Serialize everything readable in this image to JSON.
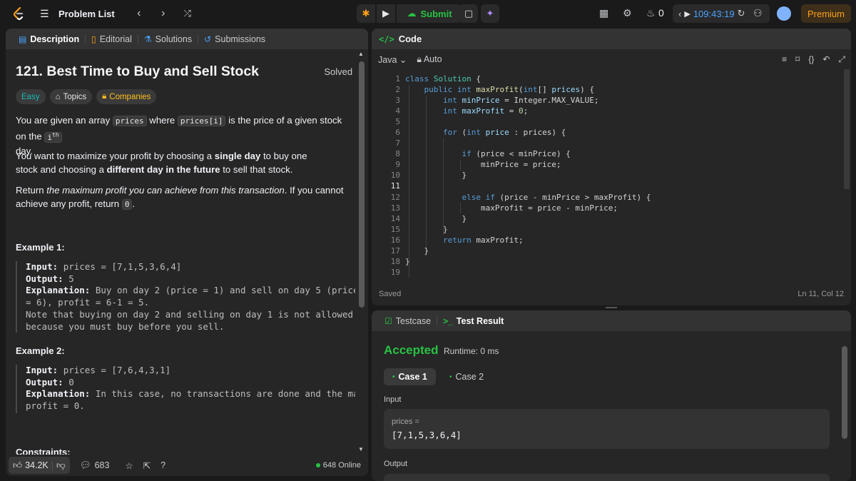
{
  "nav": {
    "problem_list_label": "Problem List",
    "submit_label": "Submit",
    "streak_count": "0",
    "timer": "109:43:19",
    "premium_label": "Premium"
  },
  "left": {
    "tabs": [
      "Description",
      "Editorial",
      "Solutions",
      "Submissions"
    ],
    "title": "121. Best Time to Buy and Sell Stock",
    "solved_label": "Solved",
    "tags": [
      "Easy",
      "Topics",
      "Companies"
    ],
    "p1_a": "You are given an array ",
    "p1_code1": "prices",
    "p1_b": " where ",
    "p1_code2": "prices[i]",
    "p1_c": " is the price of a given stock on the ",
    "p1_code3": "i",
    "p1_sup": "th",
    "p1_d": "day.",
    "p2_a": "You want to maximize your profit by choosing a ",
    "p2_b1": "single day",
    "p2_b": " to buy one stock and choosing a ",
    "p2_b2": "different day in the future",
    "p2_c": " to sell that stock.",
    "p3_a": "Return ",
    "p3_i": "the maximum profit you can achieve from this transaction",
    "p3_b": ". If you cannot achieve any profit, return ",
    "p3_code": "0",
    "p3_c": ".",
    "ex1_title": "Example 1:",
    "ex1_input": "prices = [7,1,5,3,6,4]",
    "ex1_output": "5",
    "ex1_expl": "Buy on day 2 (price = 1) and sell on day 5 (price",
    "ex1_expl2": "= 6), profit = 6-1 = 5.",
    "ex1_note1": "Note that buying on day 2 and selling on day 1 is not allowed",
    "ex1_note2": "because you must buy before you sell.",
    "ex2_title": "Example 2:",
    "ex2_input": "prices = [7,6,4,3,1]",
    "ex2_output": "0",
    "ex2_expl": "In this case, no transactions are done and the max",
    "ex2_expl2": "profit = 0.",
    "constraints_title": "Constraints:",
    "label_input": "Input:",
    "label_output": "Output:",
    "label_expl": "Explanation:",
    "likes": "34.2K",
    "comments": "683",
    "online": "648 Online"
  },
  "code": {
    "title": "Code",
    "language": "Java",
    "mode": "Auto",
    "status": "Saved",
    "cursor": "Ln 11, Col 12",
    "line_numbers": [
      "1",
      "2",
      "3",
      "4",
      "5",
      "6",
      "7",
      "8",
      "9",
      "10",
      "11",
      "12",
      "13",
      "14",
      "15",
      "16",
      "17",
      "18",
      "19"
    ]
  },
  "test": {
    "tabs": [
      "Testcase",
      "Test Result"
    ],
    "result": "Accepted",
    "runtime": "Runtime: 0 ms",
    "cases": [
      "Case 1",
      "Case 2"
    ],
    "input_label": "Input",
    "input_name": "prices =",
    "input_value": "[7,1,5,3,6,4]",
    "output_label": "Output"
  }
}
